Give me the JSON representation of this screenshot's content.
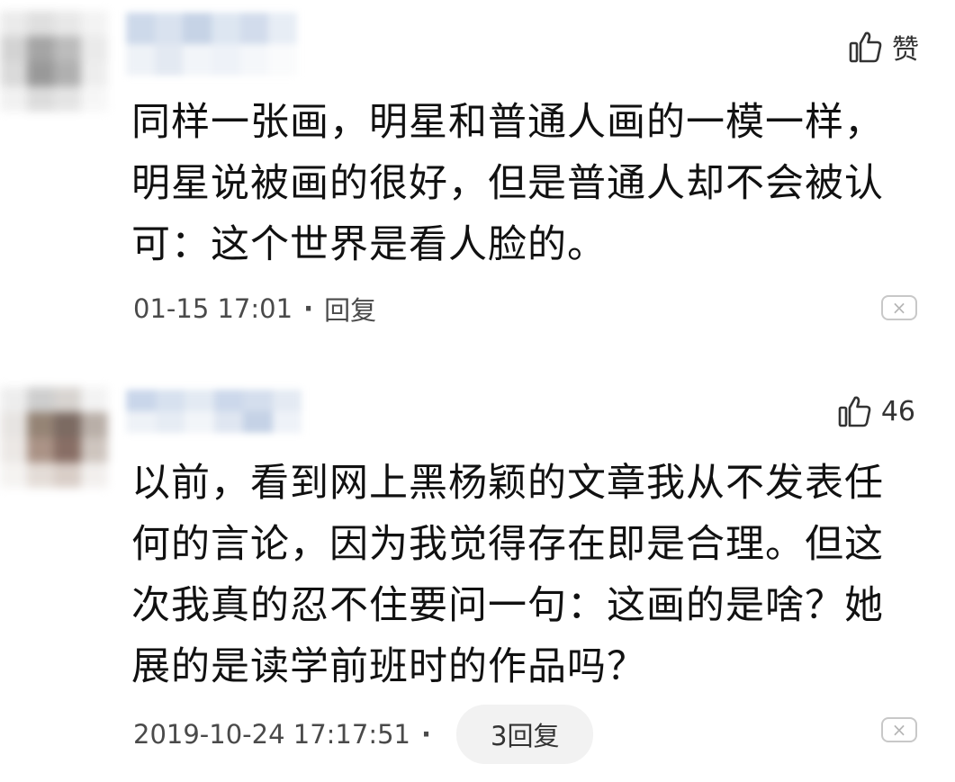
{
  "comments": [
    {
      "like_label": "赞",
      "body_lines": [
        "同样一张画，明星和普通人画的一模一样，",
        "明星说被画的很好，但是普通人却不会被认",
        "可：这个世界是看人脸的。"
      ],
      "timestamp": "01-15 17:01",
      "separator": "·",
      "reply_label": "回复",
      "dismiss_glyph": "×"
    },
    {
      "like_count": "46",
      "body_lines": [
        "以前，看到网上黑杨颖的文章我从不发表任",
        "何的言论，因为我觉得存在即是合理。但这",
        "次我真的忍不住要问一句：这画的是啥？她",
        "展的是读学前班时的作品吗？"
      ],
      "timestamp": "2019-10-24 17:17:51",
      "separator": "·",
      "reply_count_label": "3回复",
      "dismiss_glyph": "×"
    }
  ],
  "colors": {
    "text": "#111111",
    "meta": "#4a4a4a",
    "pill_bg": "#f2f2f2",
    "border": "#c8c8c8"
  },
  "icons": {
    "like": "thumbs-up-icon",
    "dismiss": "close-icon"
  }
}
